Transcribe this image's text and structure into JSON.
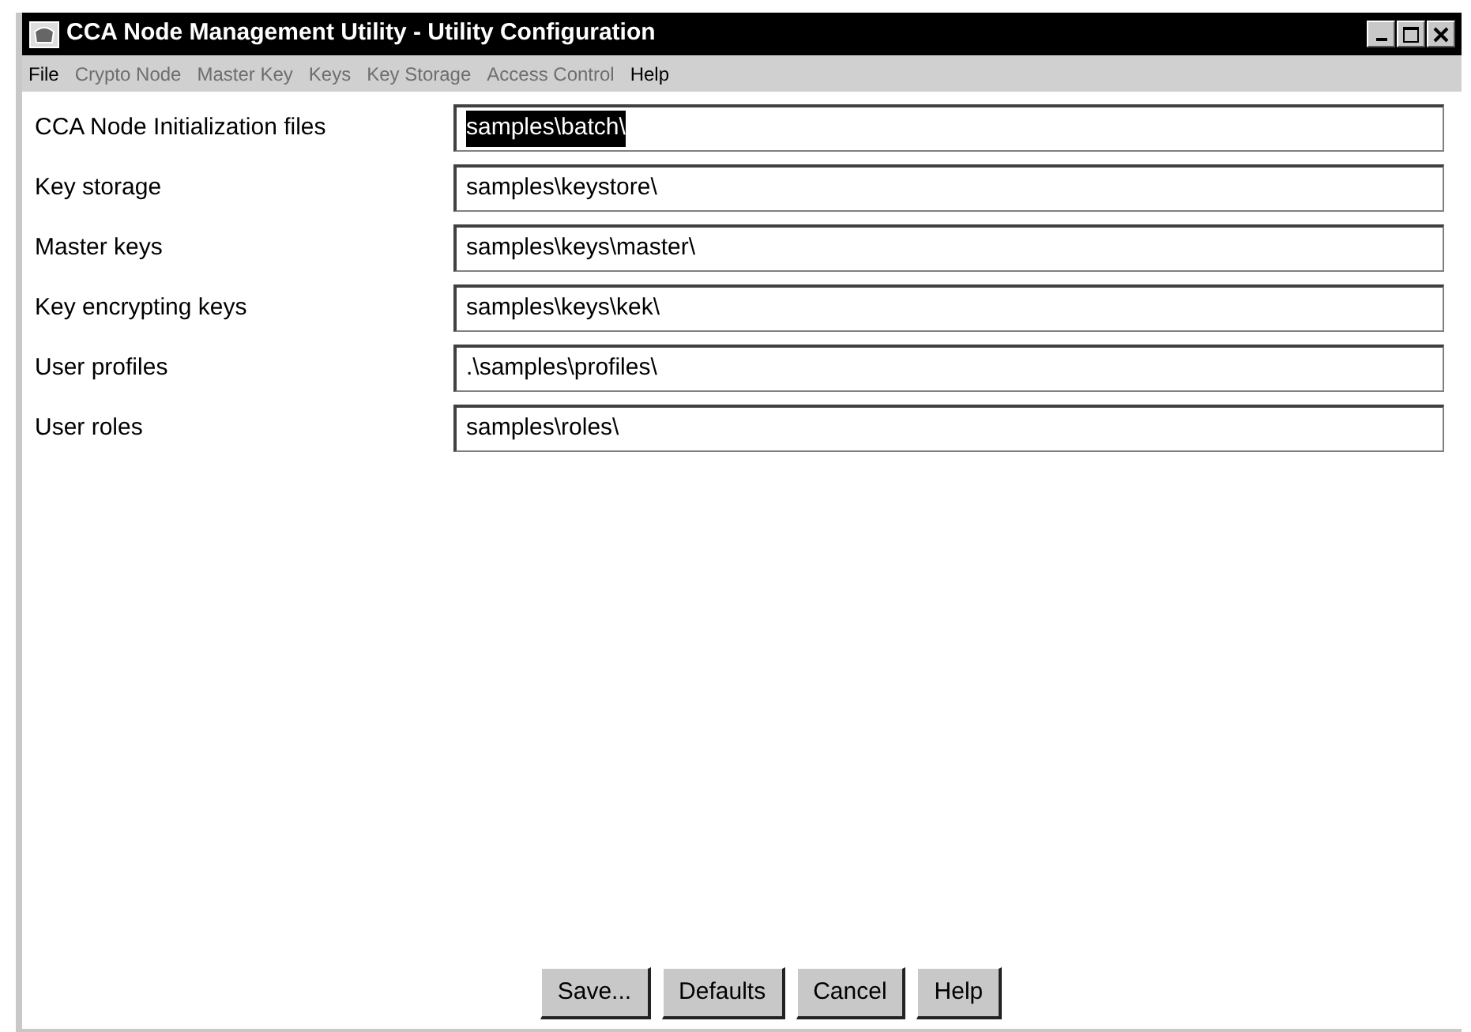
{
  "window": {
    "title": "CCA Node Management Utility - Utility Configuration"
  },
  "menu": [
    {
      "label": "File",
      "disabled": false
    },
    {
      "label": "Crypto Node",
      "disabled": true
    },
    {
      "label": "Master Key",
      "disabled": true
    },
    {
      "label": "Keys",
      "disabled": true
    },
    {
      "label": "Key Storage",
      "disabled": true
    },
    {
      "label": "Access Control",
      "disabled": true
    },
    {
      "label": "Help",
      "disabled": false
    }
  ],
  "fields": [
    {
      "label": "CCA Node Initialization files",
      "value": "samples\\batch\\",
      "selected": true
    },
    {
      "label": "Key storage",
      "value": "samples\\keystore\\",
      "selected": false
    },
    {
      "label": "Master keys",
      "value": "samples\\keys\\master\\",
      "selected": false
    },
    {
      "label": "Key encrypting keys",
      "value": "samples\\keys\\kek\\",
      "selected": false
    },
    {
      "label": "User profiles",
      "value": ".\\samples\\profiles\\",
      "selected": false
    },
    {
      "label": "User roles",
      "value": "samples\\roles\\",
      "selected": false
    }
  ],
  "buttons": [
    "Save...",
    "Defaults",
    "Cancel",
    "Help"
  ]
}
